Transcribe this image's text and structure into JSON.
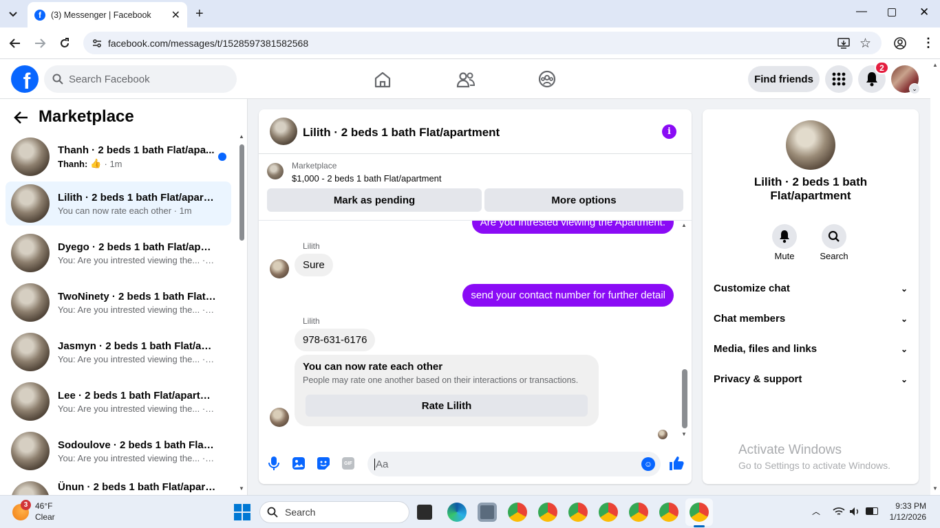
{
  "browser": {
    "tab_title": "(3) Messenger | Facebook",
    "url": "facebook.com/messages/t/1528597381582568"
  },
  "fb": {
    "search_placeholder": "Search Facebook",
    "find_friends": "Find friends",
    "notif_count": "2"
  },
  "sidebar": {
    "title": "Marketplace",
    "conversations": [
      {
        "name": "Thanh · 2 beds 1 bath Flat/apa...",
        "sub_prefix": "Thanh:",
        "time": "· 1m",
        "unread": true
      },
      {
        "name": "Lilith · 2 beds 1 bath Flat/apartm...",
        "sub": "You can now rate each other · 1m"
      },
      {
        "name": "Dyego · 2 beds 1 bath Flat/apart...",
        "sub": "You: Are you intrested viewing the... · 1m"
      },
      {
        "name": "TwoNinety · 2 beds 1 bath Flat/a...",
        "sub": "You: Are you intrested viewing the... · 1m"
      },
      {
        "name": "Jasmyn · 2 beds 1 bath Flat/apar...",
        "sub": "You: Are you intrested viewing the... · 1m"
      },
      {
        "name": "Lee · 2 beds 1 bath Flat/apartment",
        "sub": "You: Are you intrested viewing the... · 1m"
      },
      {
        "name": "Sodoulove · 2 beds 1 bath Flat/a...",
        "sub": "You: Are you intrested viewing the... · 1m"
      },
      {
        "name": "Ünun · 2 beds 1 bath Flat/apart..."
      }
    ]
  },
  "chat": {
    "title": "Lilith · 2 beds 1 bath Flat/apartment",
    "listing_source": "Marketplace",
    "listing_title": "$1,000 - 2 beds 1 bath Flat/apartment",
    "mark_pending": "Mark as pending",
    "more_options": "More options",
    "messages": {
      "out1": "Are you intrested viewing the Apartment.",
      "sender1": "Lilith",
      "in1": "Sure",
      "out2": "send your contact number for further detail",
      "sender2": "Lilith",
      "in2": "978-631-6176",
      "rate_title": "You can now rate each other",
      "rate_desc": "People may rate one another based on their interactions or transactions.",
      "rate_button": "Rate Lilith"
    },
    "composer_placeholder": "Aa"
  },
  "info_panel": {
    "name_line1": "Lilith · 2 beds 1 bath",
    "name_line2": "Flat/apartment",
    "mute": "Mute",
    "search": "Search",
    "sections": [
      "Customize chat",
      "Chat members",
      "Media, files and links",
      "Privacy & support"
    ]
  },
  "watermark": {
    "title": "Activate Windows",
    "sub": "Go to Settings to activate Windows."
  },
  "taskbar": {
    "weather_temp": "46°F",
    "weather_cond": "Clear",
    "weather_badge": "3",
    "search": "Search",
    "time": "9:33 PM",
    "date": "1/12/2026"
  },
  "colors": {
    "fb_blue": "#0866ff",
    "bubble_out": "#8a0bf5",
    "notif_red": "#e41e3f"
  }
}
